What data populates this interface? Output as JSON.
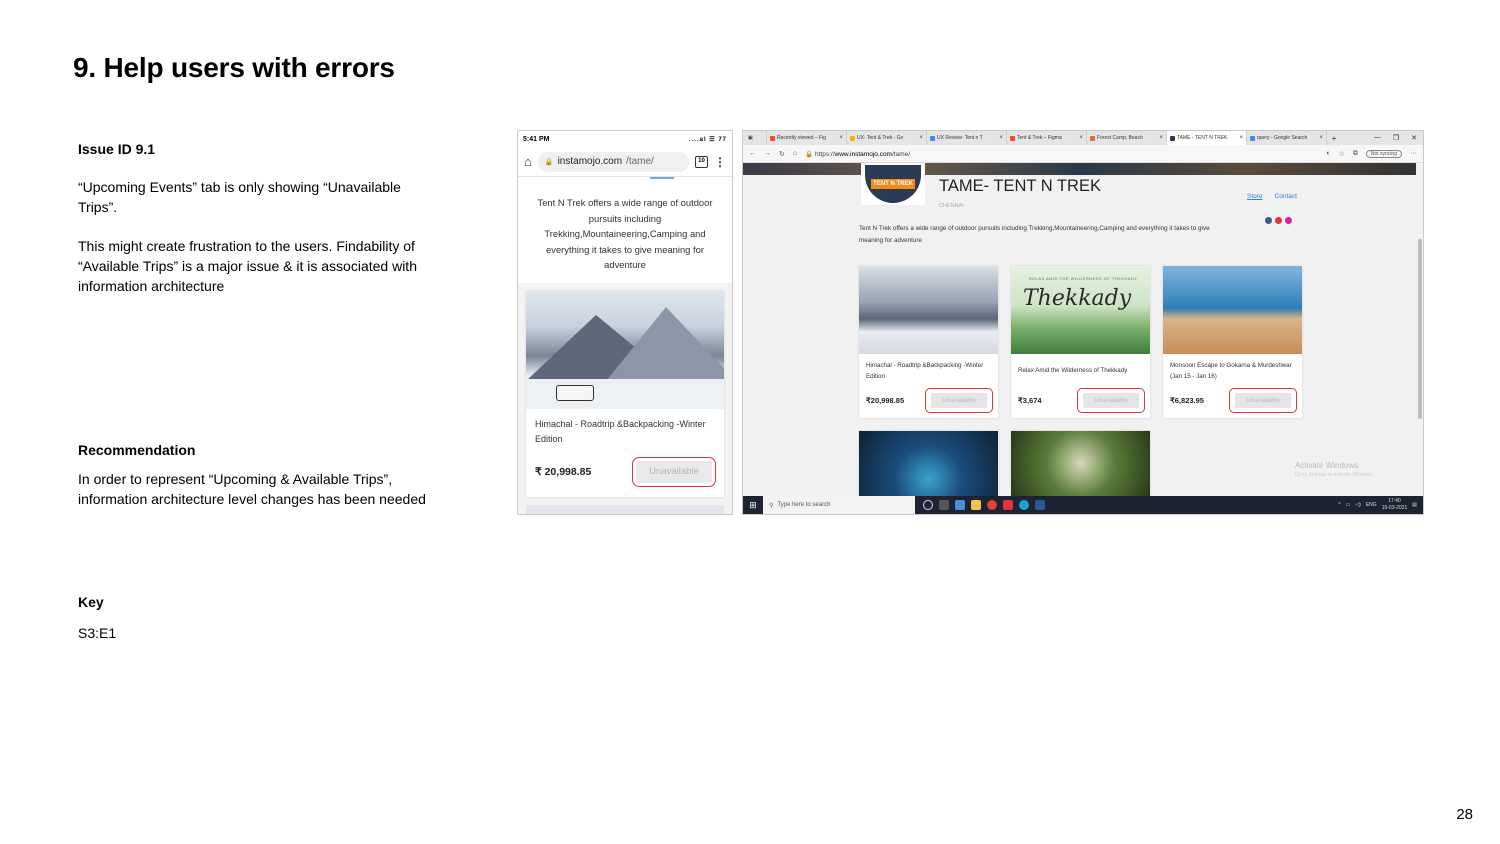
{
  "slide": {
    "title": "9. Help users with errors",
    "page_number": "28"
  },
  "issue": {
    "heading": "Issue ID 9.1",
    "paragraphs": [
      "“Upcoming Events” tab is only showing “Unavailable Trips”.",
      "This might create frustration to the users. Findability of “Available Trips” is a major issue & it is associated with information architecture"
    ]
  },
  "recommendation": {
    "heading": "Recommendation",
    "body": "In order to represent “Upcoming & Available Trips”, information architecture level changes has been needed"
  },
  "key": {
    "heading": "Key",
    "value": "S3:E1"
  },
  "mobile": {
    "time": "5:41 PM",
    "status_icons": "....al ☰ 77",
    "url_domain": "instamojo.com",
    "url_path": "/tame/",
    "tab_count": "10",
    "description": "Tent N Trek offers a wide range of outdoor pursuits including Trekking,Mountaineering,Camping and everything it takes to give meaning for adventure",
    "card": {
      "title": "Himachal - Roadtrip &Backpacking -Winter Edition",
      "price": "₹ 20,998.85",
      "button": "Unavailable"
    }
  },
  "desktop": {
    "tabs": [
      {
        "label": "Recently viewed – Fig",
        "color": "#f24e1e"
      },
      {
        "label": "UX- Tent & Trek - Go",
        "color": "#f4b400"
      },
      {
        "label": "UX Review- Tent n T",
        "color": "#4285f4"
      },
      {
        "label": "Tent & Trek – Figma",
        "color": "#f24e1e"
      },
      {
        "label": "Forest Camp, Beach",
        "color": "#e0702a"
      },
      {
        "label": "TAME - TENT N TREK",
        "color": "#2b3a55",
        "active": true
      },
      {
        "label": "query - Google Search",
        "color": "#4285f4"
      }
    ],
    "url_prefix": "https://",
    "url_domain": "www.instamojo.com",
    "url_path": "/tame/",
    "sync_label": "Not syncing",
    "logo_text": "TENT N TREK",
    "store_title": "TAME- TENT N TREK",
    "location": "CHENNAI",
    "nav": {
      "store": "Store",
      "contact": "Contact"
    },
    "description": "Tent N Trek offers a wide range of outdoor pursuits including Trekking,Mountaineering,Camping and everything it takes to give meaning for adventure",
    "thekkady_tagline": "RELAX AMID THE WILDERNESS OF THEKKADY",
    "thekkady_title": "Thekkady",
    "cards": [
      {
        "title": "Himachal - Roadtrip &Backpacking -Winter Edition",
        "price": "₹20,998.85",
        "button": "Unavailable"
      },
      {
        "title": "Relax Amid the Wilderness of Thekkady",
        "price": "₹3,674",
        "button": "Unavailable"
      },
      {
        "title": "Monsoon Escape to Gokarna & Murdeshwar (Jan 15 - Jan 16)",
        "price": "₹6,823.95",
        "button": "Unavailable"
      }
    ],
    "activate_title": "Activate Windows",
    "activate_sub": "Go to Settings to activate Windows.",
    "taskbar_search": "Type here to search",
    "tray_lang": "ENG",
    "clock_time": "17:40",
    "clock_date": "15-03-2021",
    "colors": {
      "unavailable_outline": "#e0353d",
      "link": "#3b7bd5",
      "brand_orange": "#f08b1d"
    }
  }
}
